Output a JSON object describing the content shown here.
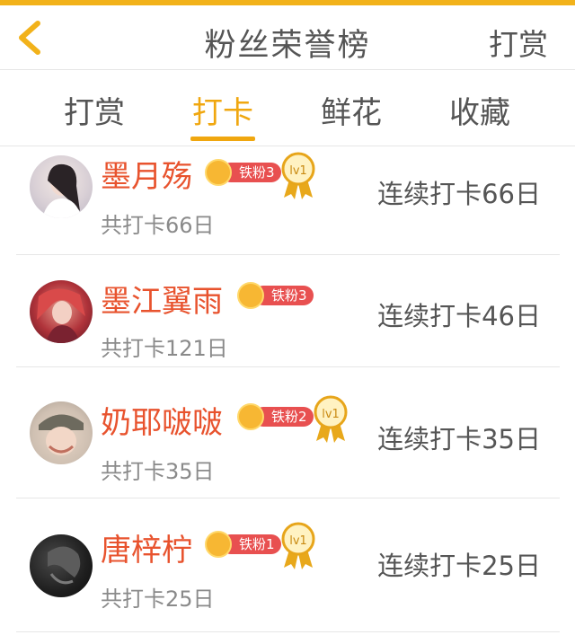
{
  "colors": {
    "accent": "#f0a70f",
    "name": "#e8532e",
    "badge": "#e85050"
  },
  "header": {
    "title": "粉丝荣誉榜",
    "action": "打赏",
    "back_icon": "chevron-left-icon"
  },
  "tabs": [
    {
      "label": "打赏",
      "active": false
    },
    {
      "label": "打卡",
      "active": true
    },
    {
      "label": "鲜花",
      "active": false
    },
    {
      "label": "收藏",
      "active": false
    }
  ],
  "fans": [
    {
      "name": "墨月殇",
      "badge": "铁粉3",
      "level": "lv1",
      "total": "共打卡66日",
      "streak": "连续打卡66日"
    },
    {
      "name": "墨江翼雨",
      "badge": "铁粉3",
      "level": "",
      "total": "共打卡121日",
      "streak": "连续打卡46日"
    },
    {
      "name": "奶耶啵啵",
      "badge": "铁粉2",
      "level": "lv1",
      "total": "共打卡35日",
      "streak": "连续打卡35日"
    },
    {
      "name": "唐梓柠",
      "badge": "铁粉1",
      "level": "lv1",
      "total": "共打卡25日",
      "streak": "连续打卡25日"
    }
  ]
}
